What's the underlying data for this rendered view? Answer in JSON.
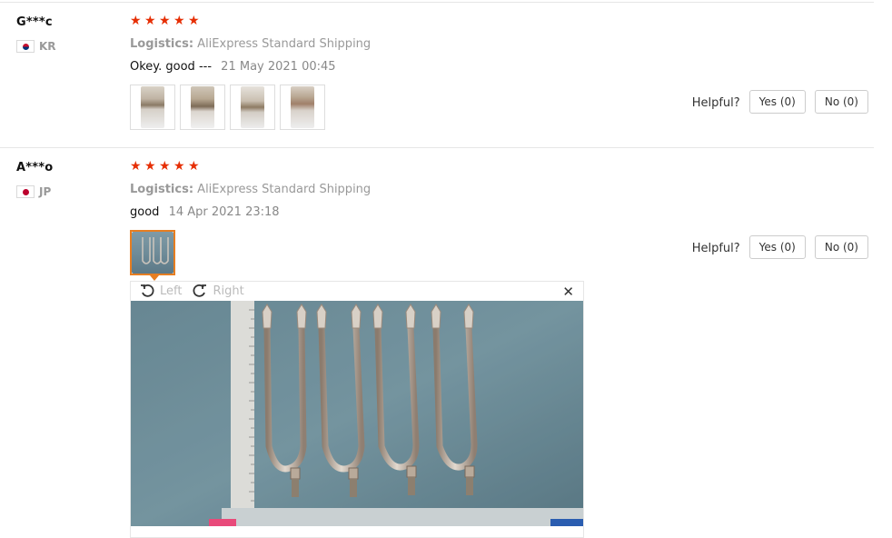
{
  "reviews": [
    {
      "user": "G***c",
      "country_code": "KR",
      "country_flag_icon": "south-korea-flag-icon",
      "rating_stars": 5,
      "logistics_label": "Logistics:",
      "logistics_value": "AliExpress Standard Shipping",
      "comment": "Okey. good ---",
      "date": "21 May 2021 00:45",
      "photo_count": 4,
      "helpful_label": "Helpful?",
      "yes_label": "Yes (0)",
      "no_label": "No (0)"
    },
    {
      "user": "A***o",
      "country_code": "JP",
      "country_flag_icon": "japan-flag-icon",
      "rating_stars": 5,
      "logistics_label": "Logistics:",
      "logistics_value": "AliExpress Standard Shipping",
      "comment": "good",
      "date": "14 Apr 2021 23:18",
      "photo_count": 1,
      "helpful_label": "Helpful?",
      "yes_label": "Yes (0)",
      "no_label": "No (0)"
    }
  ],
  "viewer": {
    "rotate_left_label": "Left",
    "rotate_right_label": "Right",
    "close_icon": "close-icon"
  },
  "colors": {
    "star": "#e62e04",
    "active_thumb_border": "#e67e22",
    "muted_text": "#999999"
  }
}
